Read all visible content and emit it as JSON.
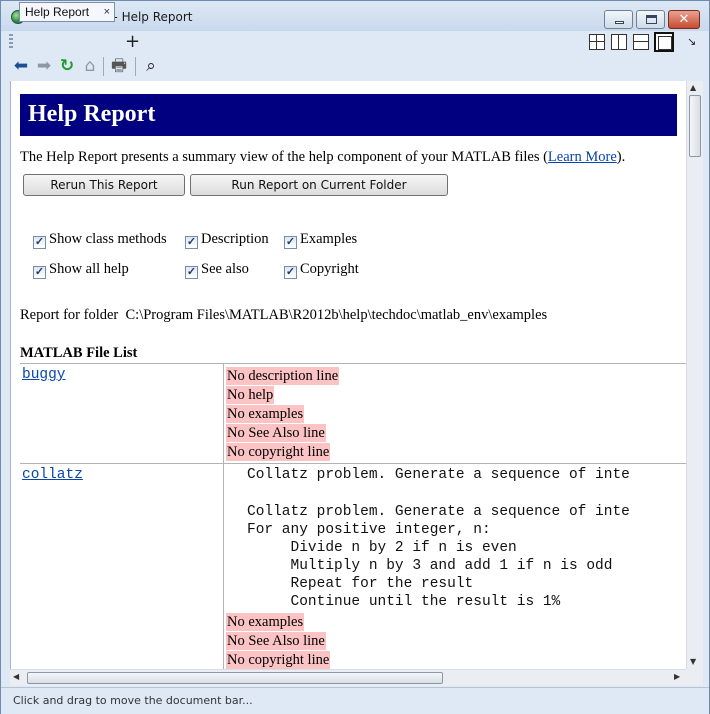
{
  "window": {
    "title": "Web Browser - Help Report",
    "close_glyph": "✕"
  },
  "tabs": [
    {
      "label": "Help Report",
      "close": "×"
    }
  ],
  "add_tab_label": "+",
  "toolbar": {
    "back_icon": "back-arrow-icon",
    "forward_icon": "forward-arrow-icon",
    "refresh_icon": "refresh-icon",
    "home_icon": "home-icon",
    "print_icon": "print-icon",
    "find_icon": "binoculars-icon",
    "glyphs": {
      "back": "⬅",
      "forward": "➡",
      "refresh": "↻",
      "home": "⌂",
      "print": "🖶",
      "find": "⌕"
    }
  },
  "page": {
    "banner_title": "Help Report",
    "intro_text": "The Help Report presents a summary view of the help component of your MATLAB files (",
    "intro_link": "Learn More",
    "intro_end": ").",
    "buttons": {
      "rerun": "Rerun This Report",
      "run_current": "Run Report on Current Folder"
    },
    "options": [
      {
        "label": "Show class methods",
        "checked": true
      },
      {
        "label": "Description",
        "checked": true
      },
      {
        "label": "Examples",
        "checked": true
      },
      {
        "label": "Show all help",
        "checked": true
      },
      {
        "label": "See also",
        "checked": true
      },
      {
        "label": "Copyright",
        "checked": true
      }
    ],
    "check_glyph": "✓",
    "folder_label": "Report for folder",
    "folder_path": "C:\\Program Files\\MATLAB\\R2012b\\help\\techdoc\\matlab_env\\examples",
    "file_list_title": "MATLAB File List",
    "files": [
      {
        "name": "buggy",
        "messages": [
          "No description line",
          "No help",
          "No examples",
          "No See Also line",
          "No copyright line"
        ]
      },
      {
        "name": "collatz",
        "description": "Collatz problem. Generate a sequence of inte",
        "help_lines": [
          "Collatz problem. Generate a sequence of inte",
          "For any positive integer, n:",
          "     Divide n by 2 if n is even",
          "     Multiply n by 3 and add 1 if n is odd",
          "     Repeat for the result",
          "     Continue until the result is 1%"
        ],
        "messages": [
          "No examples",
          "No See Also line",
          "No copyright line"
        ]
      }
    ]
  },
  "status_bar": {
    "text": "Click and drag to move the document bar..."
  },
  "scroll_glyphs": {
    "up": "▲",
    "down": "▼",
    "left": "◀",
    "right": "▶"
  }
}
